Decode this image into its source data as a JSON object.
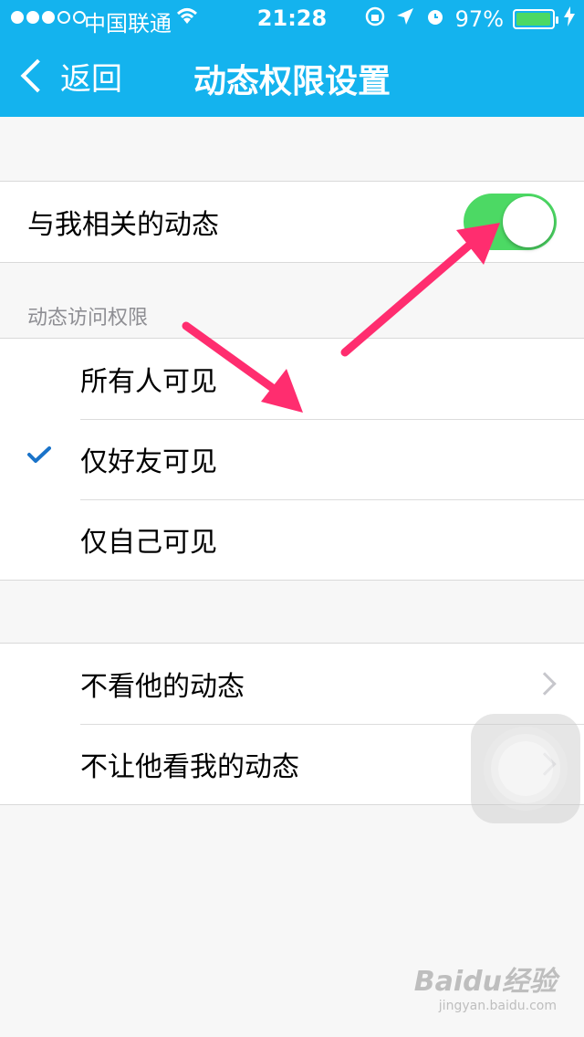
{
  "status_bar": {
    "carrier": "中国联通",
    "time": "21:28",
    "battery": "97%",
    "battery_level": 0.97,
    "signal_bars_filled": 3,
    "signal_bars_total": 5
  },
  "nav": {
    "back_label": "返回",
    "title": "动态权限设置"
  },
  "toggle_row": {
    "label": "与我相关的动态",
    "on": true
  },
  "access_section": {
    "header": "动态访问权限",
    "options": [
      {
        "label": "所有人可见",
        "selected": false
      },
      {
        "label": "仅好友可见",
        "selected": true
      },
      {
        "label": "仅自己可见",
        "selected": false
      }
    ]
  },
  "block_section": {
    "items": [
      {
        "label": "不看他的动态"
      },
      {
        "label": "不让他看我的动态"
      }
    ]
  },
  "colors": {
    "nav_bg": "#14b3ee",
    "toggle_on": "#4cd964",
    "check": "#1a73c9",
    "annotation_arrow": "#ff2d6f"
  },
  "watermark": {
    "main": "Baidu经验",
    "sub": "jingyan.baidu.com"
  }
}
